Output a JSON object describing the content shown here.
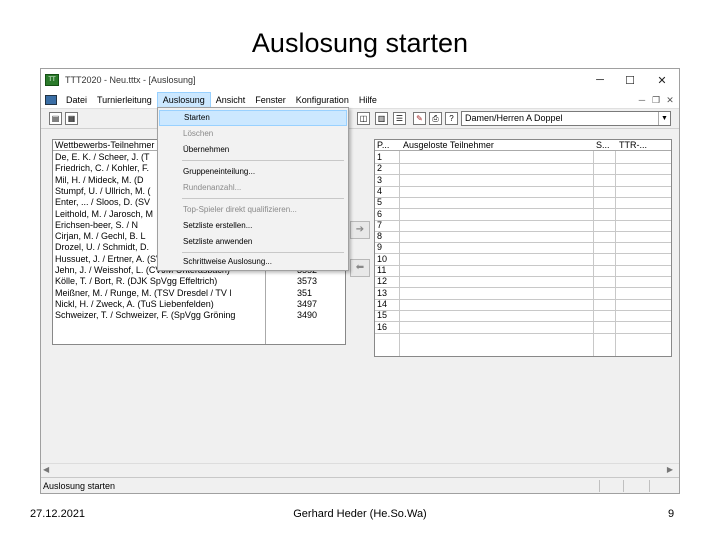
{
  "slide": {
    "title": "Auslosung starten",
    "date": "27.12.2021",
    "author": "Gerhard Heder (He.So.Wa)",
    "page": "9"
  },
  "window": {
    "title": "TTT2020 - Neu.tttx - [Auslosung]",
    "controls": {
      "minimize": "─",
      "maximize": "☐",
      "close": "✕"
    },
    "mdi_controls": {
      "minimize": "─",
      "restore": "❐",
      "close": "✕"
    }
  },
  "menu": {
    "items": [
      "Datei",
      "Turnierleitung",
      "Auslosung",
      "Ansicht",
      "Fenster",
      "Konfiguration",
      "Hilfe"
    ],
    "active": "Auslosung"
  },
  "toolbar": {
    "competition": "Damen/Herren A Doppel"
  },
  "dropdown": {
    "items": [
      {
        "label": "Starten",
        "state": "highlight"
      },
      {
        "label": "Löschen",
        "state": "disabled"
      },
      {
        "label": "Übernehmen",
        "state": "normal"
      },
      {
        "label": "Gruppeneinteilung...",
        "state": "normal"
      },
      {
        "label": "Rundenanzahl...",
        "state": "disabled"
      },
      {
        "label": "Top-Spieler direkt qualifizieren...",
        "state": "disabled"
      },
      {
        "label": "Setzliste erstellen...",
        "state": "normal"
      },
      {
        "label": "Setzliste anwenden",
        "state": "normal"
      },
      {
        "label": "Schrittweise Auslosung...",
        "state": "normal"
      }
    ]
  },
  "left_table": {
    "header": "Wettbewerbs-Teilnehmer",
    "rows": [
      {
        "name": "De, E. K. / Scheer, J. (T",
        "ttr": ""
      },
      {
        "name": "Friedrich, C. / Kohler, F.",
        "ttr": ""
      },
      {
        "name": "Mil, H. / Mideck, M. (D",
        "ttr": ""
      },
      {
        "name": "Stumpf, U. / Ullrich, M. (",
        "ttr": ""
      },
      {
        "name": "Enter, ... / Sloos, D. (SV",
        "ttr": ""
      },
      {
        "name": "Leithold, M. / Jarosch, M",
        "ttr": ""
      },
      {
        "name": "Erichsen-beer, S. / N",
        "ttr": ""
      },
      {
        "name": "Cirjan, M. / Gechl, B. L",
        "ttr": ""
      },
      {
        "name": "Drozel, U. / Schmidt, D.",
        "ttr": ""
      },
      {
        "name": "Hussuet, J. / Ertner, A. (SVL Dresden / Leibzig)",
        "ttr": "3589"
      },
      {
        "name": "Jehn, J. / Weisshof, L. (CVJM Unterasbach)",
        "ttr": "3552"
      },
      {
        "name": "Kölle, T. / Bort, R. (DJK SpVgg Effeltrich)",
        "ttr": "3573"
      },
      {
        "name": "Meißner, M. / Runge, M. (TSV Dresdel / TV l",
        "ttr": "351"
      },
      {
        "name": "Nickl, H. / Zweck, A. (TuS Liebenfelden)",
        "ttr": "3497"
      },
      {
        "name": "Schweizer, T. / Schweizer, F. (SpVgg Gröning",
        "ttr": "3490"
      }
    ]
  },
  "right_table": {
    "col_pos": "P...",
    "col_name": "Ausgeloste Teilnehmer",
    "col_s": "S...",
    "col_ttr": "TTR-...",
    "positions": [
      "1",
      "2",
      "3",
      "4",
      "5",
      "6",
      "7",
      "8",
      "9",
      "10",
      "11",
      "12",
      "13",
      "14",
      "15",
      "16"
    ]
  },
  "statusbar": {
    "text": "Auslosung starten"
  }
}
